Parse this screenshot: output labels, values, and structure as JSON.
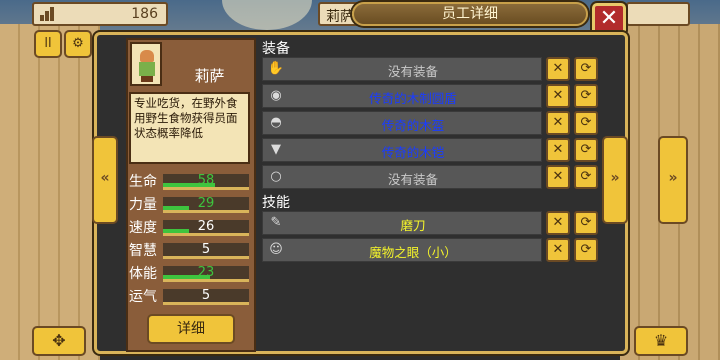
{
  "top": {
    "gold_value": "186",
    "name_tab": "莉萨",
    "title": "员工详细",
    "close_label": "✕"
  },
  "character": {
    "name": "莉萨",
    "description": "专业吃货，在野外食用野生食物获得员面状态概率降低",
    "stats": [
      {
        "label": "生命",
        "value": "58",
        "fraction": 0.6,
        "color": "#3ec43e"
      },
      {
        "label": "力量",
        "value": "29",
        "fraction": 0.3,
        "color": "#3ec43e"
      },
      {
        "label": "速度",
        "value": "26",
        "fraction": 0.3,
        "color": "#ffffff"
      },
      {
        "label": "智慧",
        "value": "5",
        "fraction": 0.0,
        "color": "#ffffff"
      },
      {
        "label": "体能",
        "value": "23",
        "fraction": 0.55,
        "color": "#3ec43e"
      },
      {
        "label": "运气",
        "value": "5",
        "fraction": 0.0,
        "color": "#ffffff"
      }
    ],
    "detail_button": "详细"
  },
  "equipment": {
    "title": "装备",
    "items": [
      {
        "text": "没有装备",
        "icon": "glove-icon",
        "glyph": "✋",
        "color": "#c9c9c9"
      },
      {
        "text": "传奇的木制圆盾",
        "icon": "shield-icon",
        "glyph": "◉",
        "color": "#1a3cff"
      },
      {
        "text": "传奇的木盔",
        "icon": "helmet-icon",
        "glyph": "◓",
        "color": "#1a3cff"
      },
      {
        "text": "传奇的木铠",
        "icon": "armor-icon",
        "glyph": "▼",
        "color": "#1a3cff"
      },
      {
        "text": "没有装备",
        "icon": "ring-icon",
        "glyph": "○",
        "color": "#c9c9c9"
      }
    ]
  },
  "skills": {
    "title": "技能",
    "items": [
      {
        "text": "磨刀",
        "icon": "whetstone-icon",
        "glyph": "✎",
        "color": "#f5f52a"
      },
      {
        "text": "魔物之眼（小）",
        "icon": "monster-eye-icon",
        "glyph": "☺",
        "color": "#f5f52a"
      }
    ]
  },
  "buttons": {
    "swap": "✕",
    "refresh": "⟳",
    "prev_inner": "«",
    "next_inner": "»",
    "prev_outer": "«",
    "next_outer": "»",
    "move": "✥",
    "crown": "♛"
  }
}
